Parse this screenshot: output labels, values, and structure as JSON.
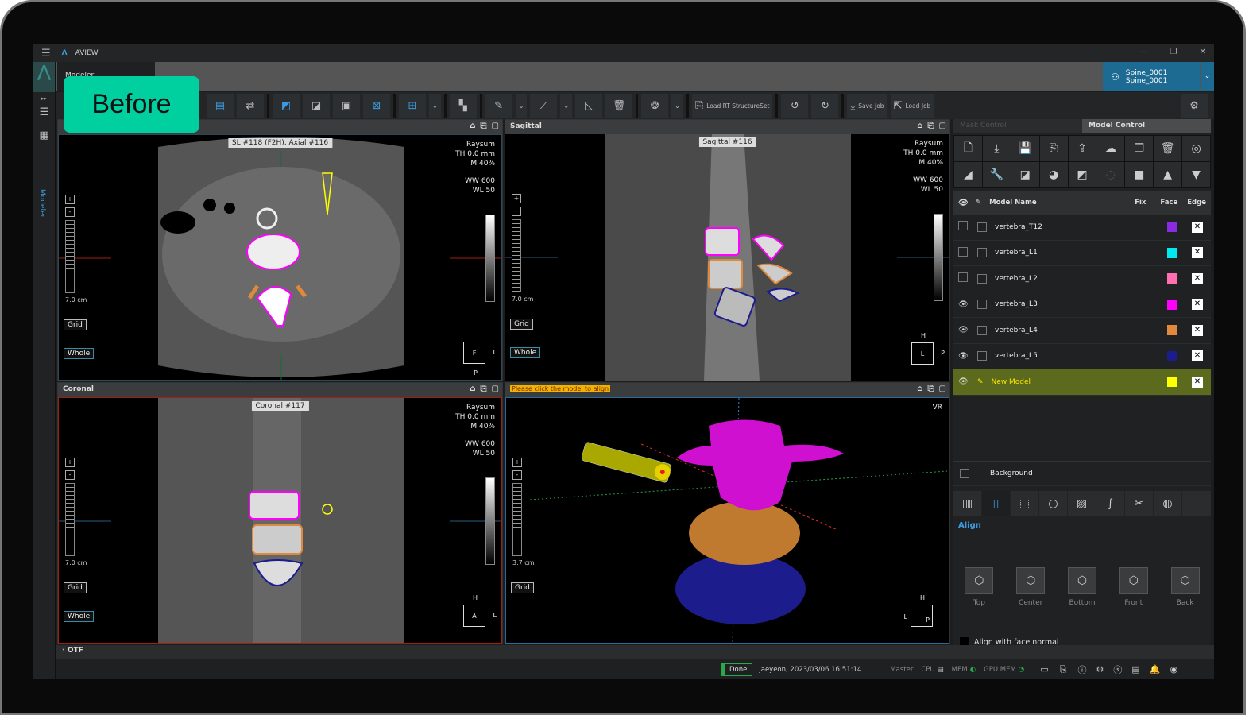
{
  "app": {
    "title": "AVIEW",
    "side_label": "Modeler",
    "tab_label": "Modeler",
    "badge": "Before"
  },
  "patient": {
    "line1": "Spine_0001",
    "line2": "Spine_0001"
  },
  "toolbar": {
    "load_rt": "Load RT StructureSet",
    "save_job": "Save Job",
    "load_job": "Load Job"
  },
  "viewports": {
    "axial": {
      "header": "",
      "label": "SL #118 (F2H),  Axial #116",
      "mode": "Raysum",
      "th": "TH 0.0 mm",
      "m": "M 40%",
      "ww": "WW   600",
      "wl": "WL    50",
      "scale": "7.0 cm",
      "grid": "Grid",
      "whole": "Whole",
      "orient": "F",
      "right": "L",
      "bottom": "P"
    },
    "sagittal": {
      "header": "Sagittal",
      "label": "Sagittal #116",
      "mode": "Raysum",
      "th": "TH 0.0 mm",
      "m": "M 40%",
      "ww": "WW   600",
      "wl": "WL    50",
      "scale": "7.0 cm",
      "grid": "Grid",
      "whole": "Whole",
      "orient": "L",
      "right": "P",
      "top": "H"
    },
    "coronal": {
      "header": "Coronal",
      "label": "Coronal #117",
      "mode": "Raysum",
      "th": "TH 0.0 mm",
      "m": "M 40%",
      "ww": "WW   600",
      "wl": "WL    50",
      "scale": "7.0 cm",
      "grid": "Grid",
      "whole": "Whole",
      "orient": "A",
      "right": "L",
      "top": "H"
    },
    "vr": {
      "header": "Please click the model to align",
      "mode": "VR",
      "scale": "3.7 cm",
      "grid": "Grid",
      "orient": "P",
      "left": "L",
      "top": "H"
    }
  },
  "panel": {
    "tabs": [
      "Mask Control",
      "Model Control"
    ],
    "columns": {
      "name": "Model Name",
      "fix": "Fix",
      "face": "Face",
      "edge": "Edge"
    },
    "models": [
      {
        "name": "vertebra_T12",
        "color": "#8a2be2",
        "visible": false
      },
      {
        "name": "vertebra_L1",
        "color": "#00e8f0",
        "visible": false
      },
      {
        "name": "vertebra_L2",
        "color": "#ff6eb0",
        "visible": false
      },
      {
        "name": "vertebra_L3",
        "color": "#ff00ff",
        "visible": true
      },
      {
        "name": "vertebra_L4",
        "color": "#e0893c",
        "visible": true
      },
      {
        "name": "vertebra_L5",
        "color": "#1c1c8c",
        "visible": true
      },
      {
        "name": "New Model",
        "color": "#ffff00",
        "visible": true,
        "selected": true
      }
    ],
    "background": "Background",
    "align_title": "Align",
    "align_buttons": [
      "Top",
      "Center",
      "Bottom",
      "Front",
      "Back"
    ],
    "align_face_normal": "Align with face normal"
  },
  "otf": "OTF",
  "status": {
    "state": "Done",
    "user_time": "jaeyeon, 2023/03/06 16:51:14",
    "master": "Master",
    "cpu": "CPU",
    "mem": "MEM",
    "gpu": "GPU MEM"
  }
}
